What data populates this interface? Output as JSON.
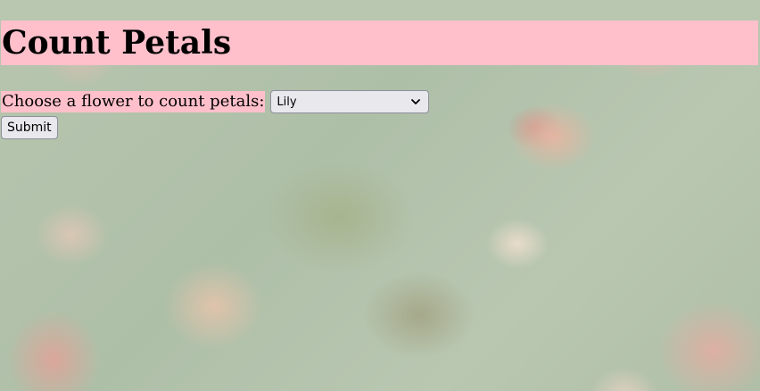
{
  "page": {
    "title": "Count Petals"
  },
  "form": {
    "label": "Choose a flower to count petals:",
    "select": {
      "selected": "Lily"
    },
    "submit_label": "Submit"
  },
  "colors": {
    "highlight": "#ffc0cb",
    "control_bg": "#e9e9ed",
    "control_border": "#8f8f9d"
  },
  "icons": {
    "select_arrow": "chevron-down-icon"
  }
}
